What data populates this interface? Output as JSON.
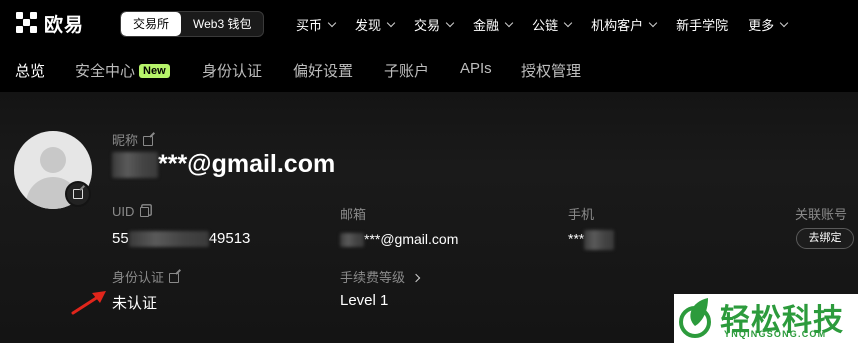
{
  "brand": {
    "name": "欧易"
  },
  "mode_toggle": {
    "exchange": "交易所",
    "web3": "Web3 钱包"
  },
  "menu": [
    {
      "label": "买币",
      "has_dropdown": true
    },
    {
      "label": "发现",
      "has_dropdown": true
    },
    {
      "label": "交易",
      "has_dropdown": true
    },
    {
      "label": "金融",
      "has_dropdown": true
    },
    {
      "label": "公链",
      "has_dropdown": true
    },
    {
      "label": "机构客户",
      "has_dropdown": true
    },
    {
      "label": "新手学院",
      "has_dropdown": false
    },
    {
      "label": "更多",
      "has_dropdown": true
    }
  ],
  "tabs": [
    {
      "label": "总览",
      "active": true
    },
    {
      "label": "安全中心",
      "badge": "New"
    },
    {
      "label": "身份认证"
    },
    {
      "label": "偏好设置"
    },
    {
      "label": "子账户"
    },
    {
      "label": "APIs"
    },
    {
      "label": "授权管理"
    }
  ],
  "profile": {
    "nickname_label": "昵称",
    "nickname_value": "***@gmail.com",
    "uid_label": "UID",
    "uid_prefix": "55",
    "uid_suffix": "49513",
    "email_label": "邮箱",
    "email_value": "***@gmail.com",
    "phone_label": "手机",
    "phone_value": "***",
    "linked_label": "关联账号",
    "unbind_label": "去绑定",
    "kyc_label": "身份认证",
    "kyc_value": "未认证",
    "fee_label": "手续费等级",
    "fee_value": "Level 1"
  },
  "watermark": {
    "title": "轻松科技",
    "sub": "YNQINGSONG.COM"
  },
  "colors": {
    "accent_badge": "#b6f36a",
    "arrow": "#e0251b",
    "watermark": "#2c9b3c"
  },
  "icons": [
    "okx-logo-icon",
    "chevron-down-icon",
    "edit-icon",
    "copy-icon",
    "chevron-right-icon",
    "avatar-placeholder-icon",
    "red-arrow-icon"
  ]
}
